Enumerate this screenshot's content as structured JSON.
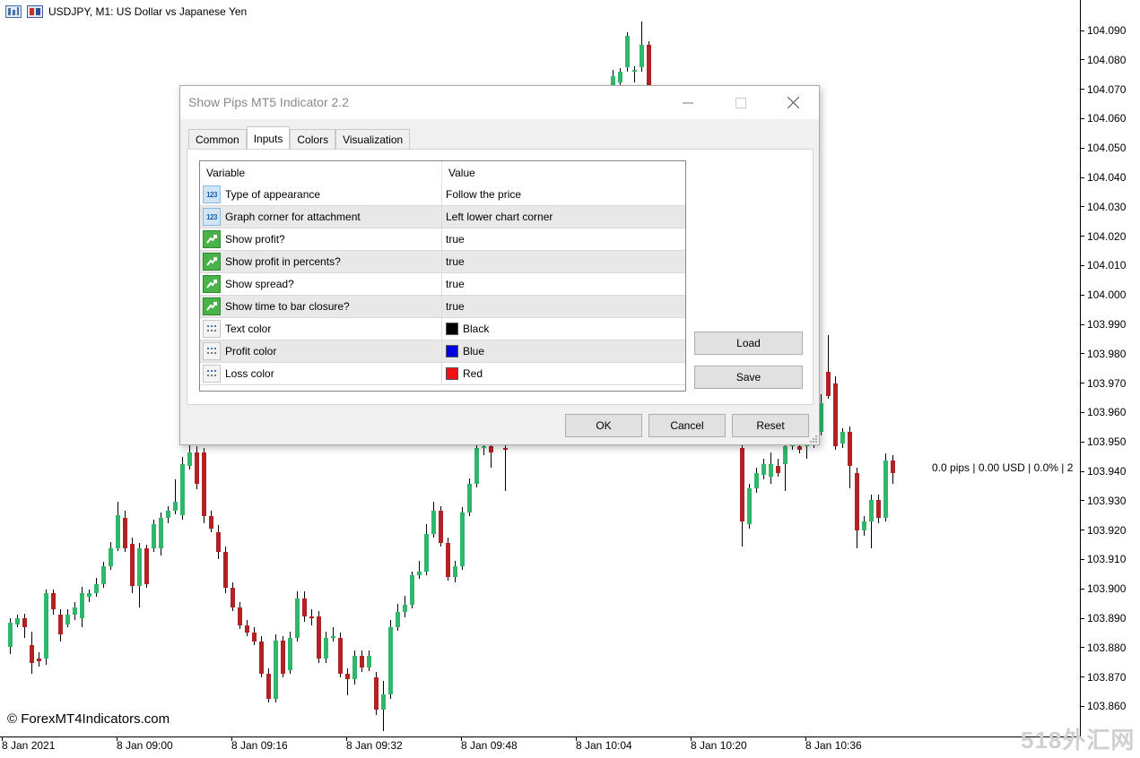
{
  "chart": {
    "title": "USDJPY, M1:  US Dollar vs Japanese Yen",
    "price_ticks": [
      "104.090",
      "104.080",
      "104.070",
      "104.060",
      "104.050",
      "104.040",
      "104.030",
      "104.020",
      "104.010",
      "104.000",
      "103.990",
      "103.980",
      "103.970",
      "103.960",
      "103.950",
      "103.940",
      "103.930",
      "103.920",
      "103.910",
      "103.900",
      "103.890",
      "103.880",
      "103.870",
      "103.860"
    ],
    "time_ticks": [
      "8 Jan 2021",
      "8 Jan 09:00",
      "8 Jan 09:16",
      "8 Jan 09:32",
      "8 Jan 09:48",
      "8 Jan 10:04",
      "8 Jan 10:20",
      "8 Jan 10:36"
    ],
    "pips_label": "0.0 pips | 0.00 USD | 0.0% | 2",
    "copyright": "© ForexMT4Indicators.com",
    "watermark": "518外汇网",
    "bull_color": "#2fb86a",
    "bear_color": "#b22222"
  },
  "dialog": {
    "title": "Show Pips MT5 Indicator 2.2",
    "tabs": [
      "Common",
      "Inputs",
      "Colors",
      "Visualization"
    ],
    "active_tab": "Inputs",
    "grid": {
      "header": {
        "variable": "Variable",
        "value": "Value"
      },
      "rows": [
        {
          "icon": "numeric-icon",
          "variable": "Type of appearance",
          "value": "Follow the price"
        },
        {
          "icon": "numeric-icon",
          "variable": "Graph corner for attachment",
          "value": "Left lower chart corner"
        },
        {
          "icon": "boolean-icon",
          "variable": "Show profit?",
          "value": "true"
        },
        {
          "icon": "boolean-icon",
          "variable": "Show profit in percents?",
          "value": "true"
        },
        {
          "icon": "boolean-icon",
          "variable": "Show spread?",
          "value": "true"
        },
        {
          "icon": "boolean-icon",
          "variable": "Show time to bar closure?",
          "value": "true"
        },
        {
          "icon": "color-icon",
          "variable": "Text color",
          "value": "Black",
          "swatch": "#000000"
        },
        {
          "icon": "color-icon",
          "variable": "Profit color",
          "value": "Blue",
          "swatch": "#0000dd"
        },
        {
          "icon": "color-icon",
          "variable": "Loss color",
          "value": "Red",
          "swatch": "#ee1111"
        }
      ]
    },
    "buttons": {
      "load": "Load",
      "save": "Save",
      "ok": "OK",
      "cancel": "Cancel",
      "reset": "Reset"
    }
  }
}
